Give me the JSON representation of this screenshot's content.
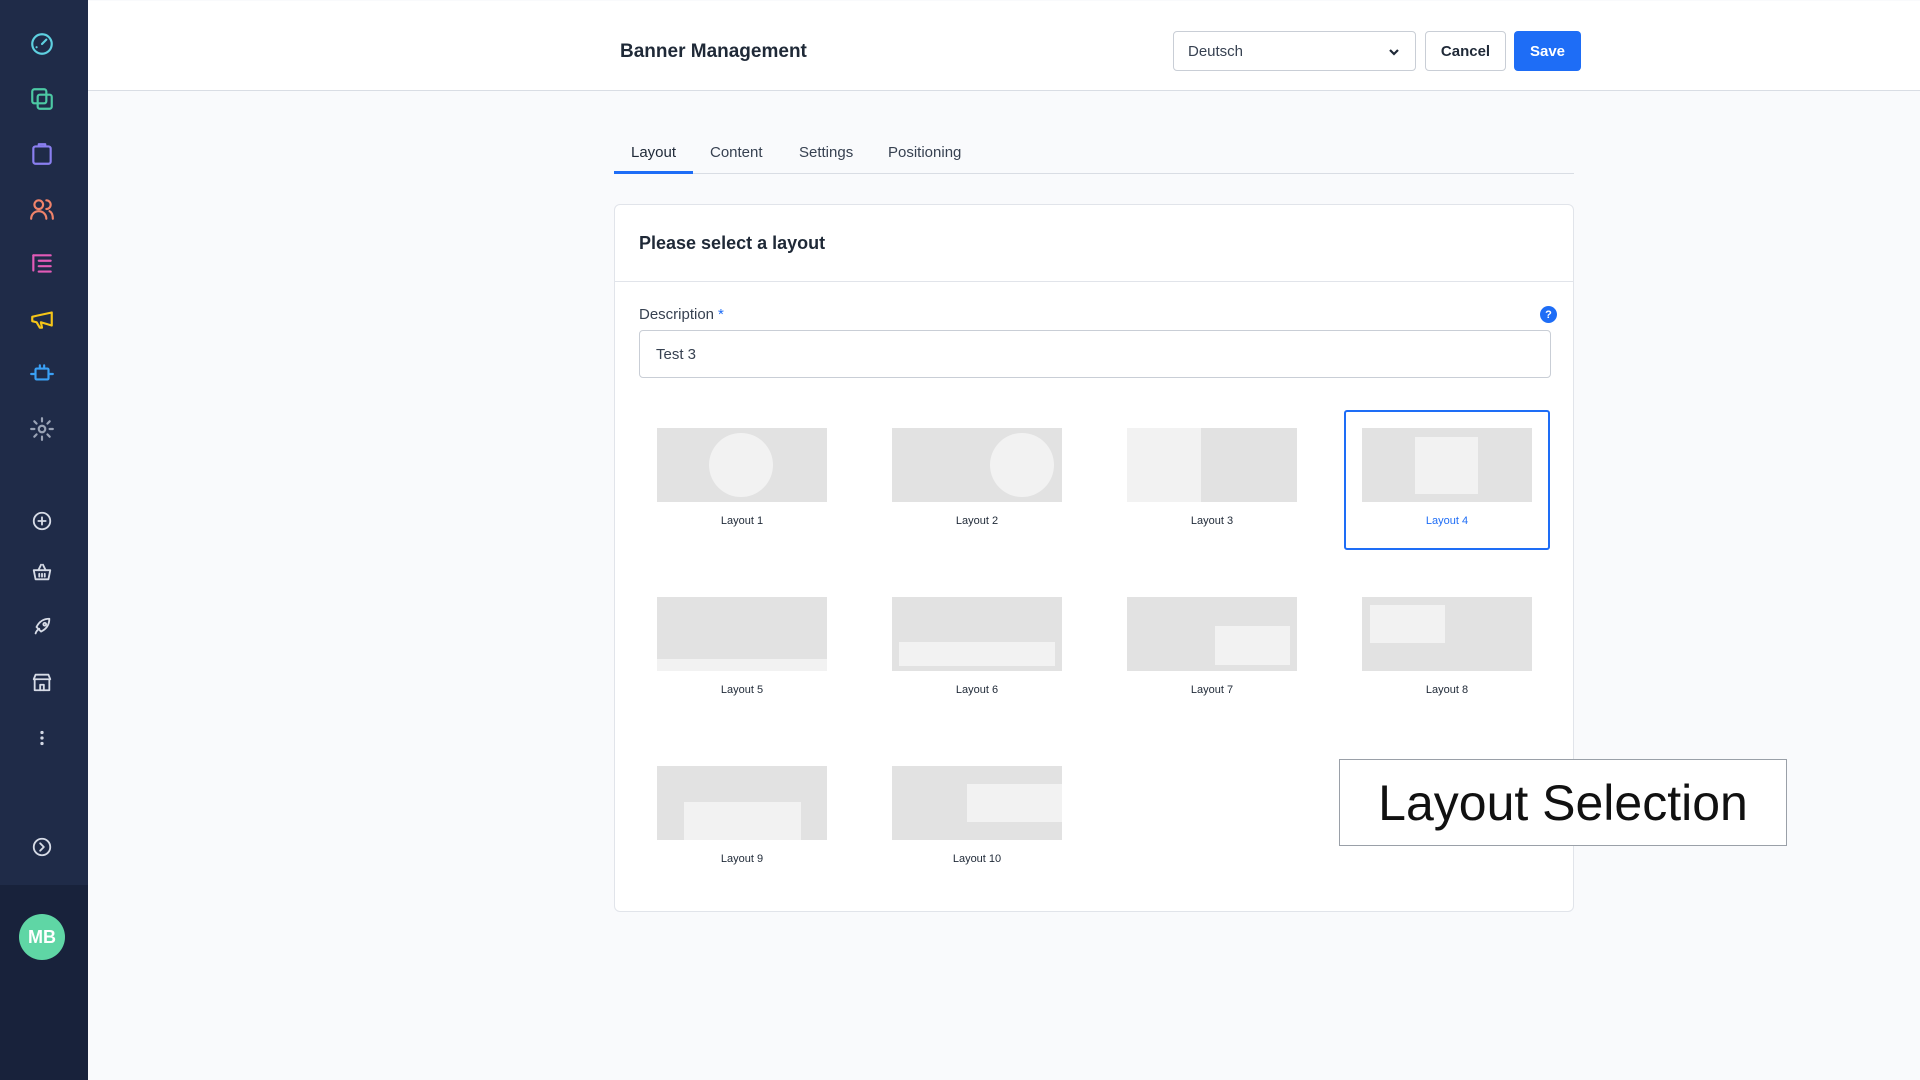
{
  "sidebar": {
    "icons": [
      {
        "name": "dashboard-icon",
        "color": "#5ed0e0"
      },
      {
        "name": "catalog-icon",
        "color": "#4cc9a4"
      },
      {
        "name": "orders-icon",
        "color": "#8a7ff0"
      },
      {
        "name": "customers-icon",
        "color": "#f0836a"
      },
      {
        "name": "content-icon",
        "color": "#e35bb7"
      },
      {
        "name": "marketing-icon",
        "color": "#f5c518"
      },
      {
        "name": "extensions-icon",
        "color": "#3aa0f5"
      },
      {
        "name": "settings-icon",
        "color": "#9aa3b5"
      },
      {
        "name": "add-circle-icon",
        "color": "#d6dbe6"
      },
      {
        "name": "basket-icon",
        "color": "#d6dbe6"
      },
      {
        "name": "rocket-icon",
        "color": "#d6dbe6"
      },
      {
        "name": "store-icon",
        "color": "#d6dbe6"
      },
      {
        "name": "more-vertical-icon",
        "color": "#d6dbe6"
      },
      {
        "name": "expand-sidebar-icon",
        "color": "#d6dbe6"
      }
    ],
    "avatar_initials": "MB"
  },
  "header": {
    "title": "Banner Management",
    "language": "Deutsch",
    "cancel_label": "Cancel",
    "save_label": "Save"
  },
  "tabs": [
    {
      "label": "Layout",
      "active": true
    },
    {
      "label": "Content",
      "active": false
    },
    {
      "label": "Settings",
      "active": false
    },
    {
      "label": "Positioning",
      "active": false
    }
  ],
  "card": {
    "title": "Please select a layout",
    "description_label": "Description",
    "required_mark": "*",
    "help_icon_glyph": "?",
    "description_value": "Test 3"
  },
  "layouts": [
    {
      "label": "Layout 1",
      "selected": false
    },
    {
      "label": "Layout 2",
      "selected": false
    },
    {
      "label": "Layout 3",
      "selected": false
    },
    {
      "label": "Layout 4",
      "selected": true
    },
    {
      "label": "Layout 5",
      "selected": false
    },
    {
      "label": "Layout 6",
      "selected": false
    },
    {
      "label": "Layout 7",
      "selected": false
    },
    {
      "label": "Layout 8",
      "selected": false
    },
    {
      "label": "Layout 9",
      "selected": false
    },
    {
      "label": "Layout 10",
      "selected": false
    }
  ],
  "caption": "Layout Selection",
  "colors": {
    "accent": "#1e6df6",
    "sidebar_bg": "#1f2b48",
    "avatar_bg": "#5fd6a5",
    "thumb_bg": "#e2e2e2",
    "thumb_shape": "#f2f2f2"
  }
}
